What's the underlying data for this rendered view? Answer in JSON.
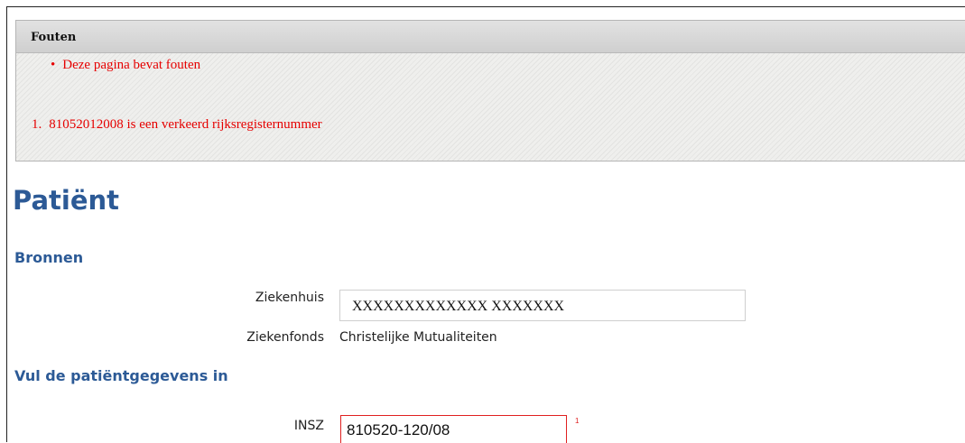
{
  "errors": {
    "header": "Fouten",
    "bullet": "Deze pagina bevat fouten",
    "items": [
      {
        "number": "1.",
        "text": "81052012008 is een verkeerd rijksregisternummer"
      }
    ]
  },
  "page": {
    "title": "Patiënt"
  },
  "sections": {
    "bronnen": {
      "title": "Bronnen",
      "ziekenhuis_label": "Ziekenhuis",
      "ziekenhuis_value": "XXXXXXXXXXXXX XXXXXXX",
      "ziekenfonds_label": "Ziekenfonds",
      "ziekenfonds_value": "Christelijke Mutualiteiten"
    },
    "patient": {
      "title": "Vul de patiëntgegevens in",
      "insz_label": "INSZ",
      "insz_value": "810520-120/08",
      "insz_error_ref": "1"
    }
  },
  "colors": {
    "error": "#e60000",
    "heading": "#2c5a96",
    "invalid_border": "#e02020"
  }
}
